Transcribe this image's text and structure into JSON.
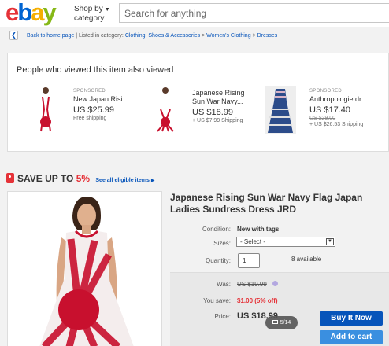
{
  "header": {
    "logo": [
      "e",
      "b",
      "a",
      "y"
    ],
    "shop_by_line1": "Shop by",
    "shop_by_line2": "category",
    "search_placeholder": "Search for anything"
  },
  "breadcrumb": {
    "back_label": "Back to home page",
    "separator": "| Listed in category:",
    "items": [
      "Clothing, Shoes & Accessories",
      "Women's Clothing",
      "Dresses"
    ],
    "arrow": ">"
  },
  "also_viewed": {
    "title": "People who viewed this item also viewed",
    "items": [
      {
        "sponsored": "SPONSORED",
        "title": "New Japan Risi...",
        "price": "US $25.99",
        "old_price": "",
        "shipping": "Free shipping"
      },
      {
        "sponsored": "",
        "title": "Japanese Rising Sun War Navy...",
        "price": "US $18.99",
        "old_price": "",
        "shipping": "+ US $7.99 Shipping"
      },
      {
        "sponsored": "SPONSORED",
        "title": "Anthropologie dr...",
        "price": "US $17.40",
        "old_price": "US $29.00",
        "shipping": "+ US $26.53 Shipping"
      }
    ]
  },
  "save_banner": {
    "prefix": "SAVE UP TO",
    "percent": "5%",
    "link": "See all eligible items"
  },
  "product": {
    "title": "Japanese Rising Sun War Navy Flag Japan Ladies Sundress Dress JRD",
    "condition_label": "Condition:",
    "condition_value": "New with tags",
    "sizes_label": "Sizes:",
    "sizes_selected": "- Select -",
    "quantity_label": "Quantity:",
    "quantity_value": "1",
    "available": "8 available",
    "was_label": "Was:",
    "was_value": "US $19.99",
    "you_save_label": "You save:",
    "you_save_value": "$1.00 (5% off)",
    "price_label": "Price:",
    "price_value": "US $18.99",
    "image_counter": "5/14",
    "buy_now": "Buy It Now",
    "add_to_cart": "Add to cart"
  },
  "colors": {
    "accent_blue": "#0654ba",
    "sale_red": "#e53238",
    "flag_red": "#c8102e"
  }
}
